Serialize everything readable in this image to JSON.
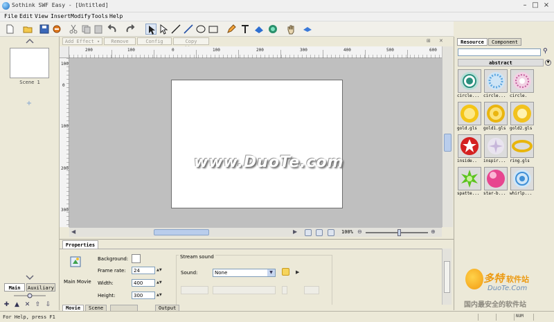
{
  "window": {
    "title": "Sothink SWF Easy - [Untitled]",
    "minimize": "–",
    "maximize": "□",
    "close": "×"
  },
  "menu": [
    "File",
    "Edit",
    "View",
    "Insert",
    "Modify",
    "Tools",
    "Help"
  ],
  "toolbar_icons": [
    "new-icon",
    "open-icon",
    "save-icon",
    "publish-icon",
    "cut-icon",
    "copy-icon",
    "paste-icon",
    "undo-icon",
    "redo-icon",
    "select-icon",
    "subselect-icon",
    "line-icon",
    "pen-line-icon",
    "ellipse-icon",
    "rectangle-icon",
    "pencil-icon",
    "text-icon",
    "fill-icon",
    "sound-icon",
    "hand-icon",
    "zoom-icon"
  ],
  "scene_panel": {
    "scene_label": "Scene 1",
    "tabs": [
      "Main",
      "Auxiliary"
    ]
  },
  "effects_bar": {
    "add_effect": "Add Effect ▾",
    "remove": "Remove",
    "config": "Config",
    "copy_effects": "Copy Effects"
  },
  "ruler": {
    "h_ticks": [
      "200",
      "100",
      "0",
      "100",
      "200",
      "300",
      "400",
      "500",
      "600"
    ],
    "v_ticks": [
      "100",
      "0",
      "100",
      "200",
      "300"
    ]
  },
  "zoom": {
    "value": "100%"
  },
  "watermark": "www.DuoTe.com",
  "properties": {
    "tab": "Properties",
    "movie_label": "Main Movie",
    "background_label": "Background:",
    "frame_rate_label": "Frame rate:",
    "frame_rate": "24",
    "width_label": "Width:",
    "width": "400",
    "height_label": "Height:",
    "height": "300",
    "stream_sound_label": "Stream sound",
    "sound_label": "Sound:",
    "sound_value": "None"
  },
  "bottom_tabs": [
    "Movie",
    "Scene",
    "",
    "Output"
  ],
  "resource": {
    "tabs": [
      "Resource",
      "Component"
    ],
    "category": "abstract",
    "items": [
      {
        "label": "circle...",
        "icon": "circle-teal-icon"
      },
      {
        "label": "circle...",
        "icon": "circle-blue-icon"
      },
      {
        "label": "circle.",
        "icon": "circle-pink-icon"
      },
      {
        "label": "gold.gls",
        "icon": "gold-icon"
      },
      {
        "label": "gold1.gls",
        "icon": "gold1-icon"
      },
      {
        "label": "gold2.gls",
        "icon": "gold2-icon"
      },
      {
        "label": "inside..",
        "icon": "star-red-icon"
      },
      {
        "label": "inspir...",
        "icon": "inspire-icon"
      },
      {
        "label": "ring.gls",
        "icon": "ring-icon"
      },
      {
        "label": "spatte...",
        "icon": "splatter-icon"
      },
      {
        "label": "star-b...",
        "icon": "star-ball-icon"
      },
      {
        "label": "whirlp...",
        "icon": "whirlpool-icon"
      }
    ]
  },
  "logo": {
    "brand": "多特",
    "brand_suffix": "软件站",
    "url": "DuoTe.Com",
    "slogan": "国内最安全的软件站"
  },
  "status": {
    "text": "For Help, press F1",
    "cells": [
      "",
      "",
      "NUM",
      ""
    ]
  }
}
